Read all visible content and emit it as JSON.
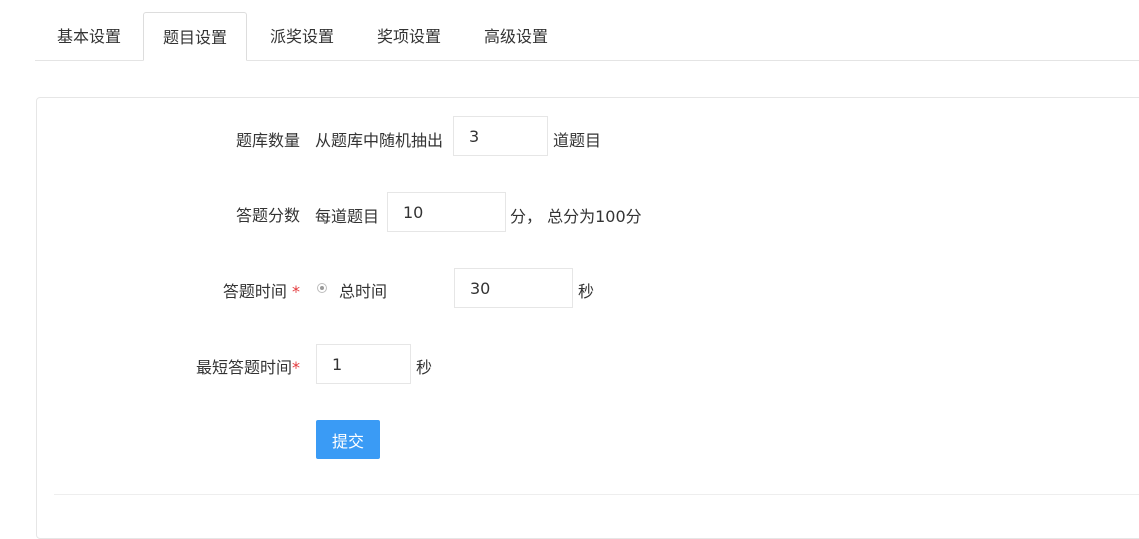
{
  "tabs": [
    {
      "label": "基本设置",
      "active": false
    },
    {
      "label": "题目设置",
      "active": true
    },
    {
      "label": "派奖设置",
      "active": false
    },
    {
      "label": "奖项设置",
      "active": false
    },
    {
      "label": "高级设置",
      "active": false
    }
  ],
  "form": {
    "question_count": {
      "label": "题库数量",
      "prefix": "从题库中随机抽出",
      "value": "3",
      "suffix": "道题目"
    },
    "score": {
      "label": "答题分数",
      "prefix": "每道题目",
      "value": "10",
      "suffix": "分， 总分为100分"
    },
    "answer_time": {
      "label": "答题时间",
      "required_mark": "*",
      "radio_label": "总时间",
      "radio_checked": true,
      "value": "30",
      "suffix": "秒"
    },
    "min_time": {
      "label": "最短答题时间",
      "required_mark": "*",
      "value": "1",
      "suffix": "秒"
    },
    "submit_label": "提交"
  },
  "colors": {
    "primary": "#3a9bf5",
    "required": "#e4393c"
  }
}
